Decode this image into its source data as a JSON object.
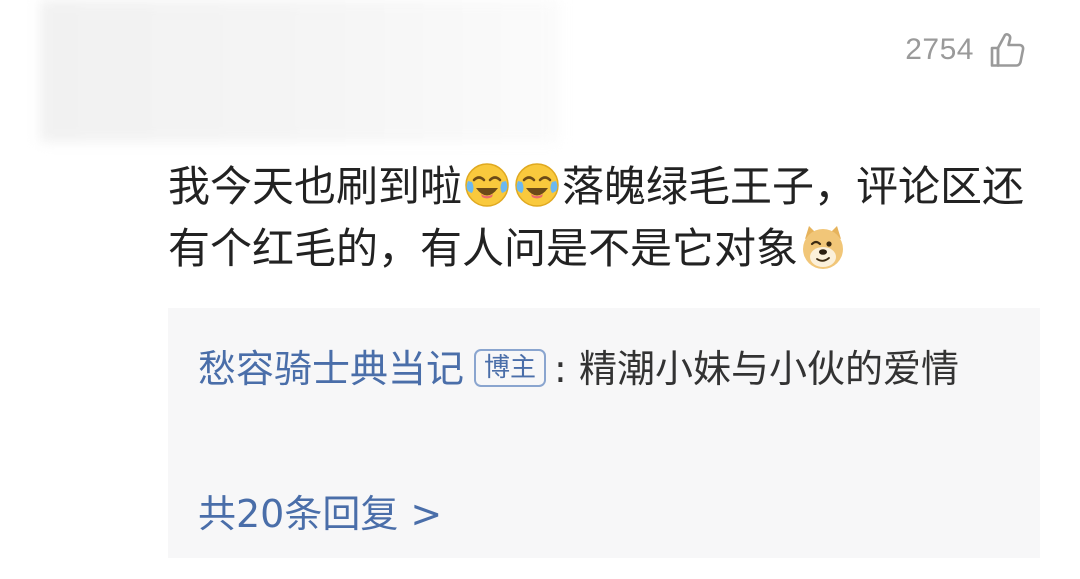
{
  "comment": {
    "like_count": "2754",
    "text_part1": "我今天也刷到啦",
    "text_part2": "落魄绿毛王子，评论区还有个红毛的，有人问是不是它对象",
    "emoji_laugh_cry": "laugh-cry-emoji",
    "emoji_doge": "doge-emoji"
  },
  "reply": {
    "author": "愁容骑士典当记",
    "badge": "博主",
    "separator": ":",
    "text": "精潮小妹与小伙的爱情",
    "more_label": "共20条回复 >"
  },
  "colors": {
    "link_blue": "#4a6ea9",
    "reply_bg": "#f7f7f8",
    "like_gray": "#9a9a9a"
  }
}
